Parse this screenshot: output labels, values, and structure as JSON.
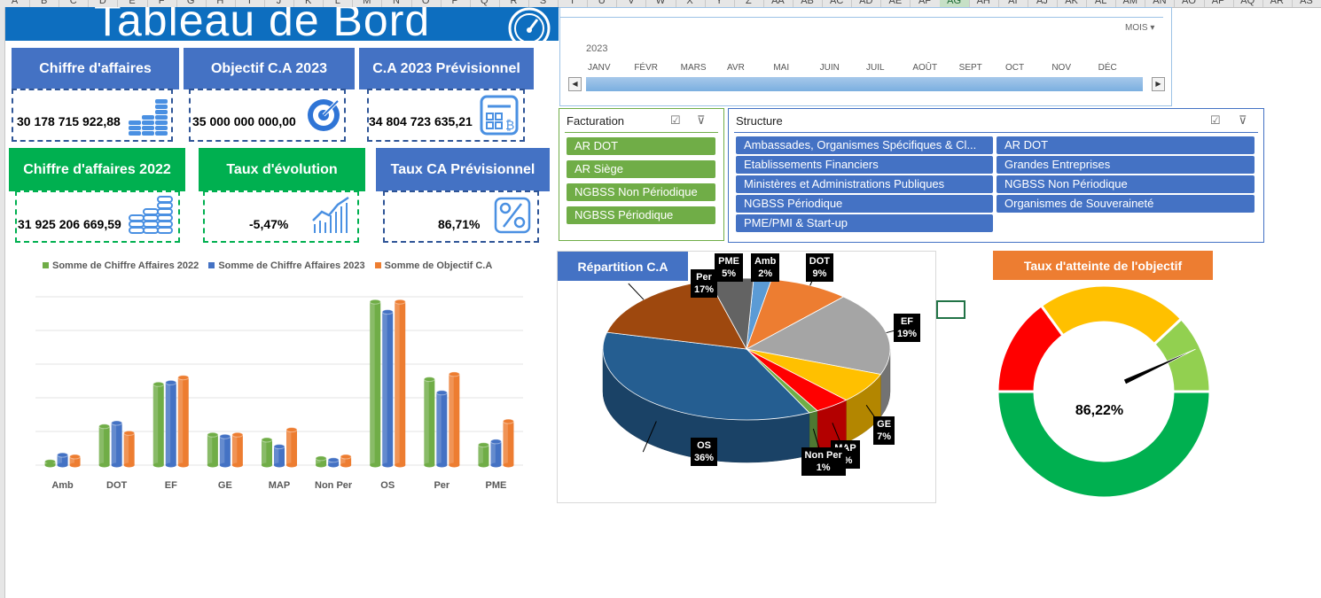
{
  "app": {
    "column_headers": [
      "A",
      "B",
      "C",
      "D",
      "E",
      "F",
      "G",
      "H",
      "I",
      "J",
      "K",
      "L",
      "M",
      "N",
      "O",
      "P",
      "Q",
      "R",
      "S",
      "T",
      "U",
      "V",
      "W",
      "X",
      "Y",
      "Z",
      "AA",
      "AB",
      "AC",
      "AD",
      "AE",
      "AF",
      "AG",
      "AH",
      "AI",
      "AJ",
      "AK",
      "AL",
      "AM",
      "AN",
      "AO",
      "AP",
      "AQ",
      "AR",
      "AS"
    ],
    "selected_column": "AG"
  },
  "dashboard": {
    "title": "Tableau de Bord",
    "kpis": [
      {
        "label": "Chiffre d'affaires",
        "value": "30 178 715 922,88",
        "icon": "coins-stack-icon",
        "color": "#4472c4"
      },
      {
        "label": "Objectif C.A 2023",
        "value": "35 000 000 000,00",
        "icon": "target-icon",
        "color": "#4472c4"
      },
      {
        "label": "C.A 2023 Prévisionnel",
        "value": "34 804 723 635,21",
        "icon": "calculator-icon",
        "color": "#4472c4"
      },
      {
        "label": "Chiffre d'affaires 2022",
        "value": "31 925 206 669,59",
        "icon": "coins-stack-icon",
        "color": "#00b050"
      },
      {
        "label": "Taux d'évolution",
        "value": "-5,47%",
        "icon": "growth-chart-icon",
        "color": "#00b050"
      },
      {
        "label": "Taux CA Prévisionnel",
        "value": "86,71%",
        "icon": "percent-icon",
        "color": "#4472c4"
      }
    ]
  },
  "timeline": {
    "period_label": "MOIS",
    "year": "2023",
    "months": [
      "JANV",
      "FÉVR",
      "MARS",
      "AVR",
      "MAI",
      "JUIN",
      "JUIL",
      "AOÛT",
      "SEPT",
      "OCT",
      "NOV",
      "DÉC"
    ]
  },
  "slicers": {
    "facturation": {
      "title": "Facturation",
      "items": [
        "AR DOT",
        "AR Siège",
        "NGBSS Non Périodique",
        "NGBSS Périodique"
      ]
    },
    "structure": {
      "title": "Structure",
      "items": [
        "Ambassades, Organismes Spécifiques & Cl...",
        "AR DOT",
        "Etablissements Financiers",
        "Grandes Entreprises",
        "Ministères et Administrations Publiques",
        "NGBSS Non Périodique",
        "NGBSS Périodique",
        "Organismes de Souveraineté",
        "PME/PMI & Start-up"
      ]
    }
  },
  "chart_data": [
    {
      "type": "bar",
      "title": "",
      "categories": [
        "Amb",
        "DOT",
        "EF",
        "GE",
        "MAP",
        "Non Per",
        "OS",
        "Per",
        "PME"
      ],
      "series": [
        {
          "name": "Somme de Chiffre Affaires 2022",
          "color": "#70ad47",
          "values": [
            0.2,
            2.3,
            4.8,
            1.8,
            1.5,
            0.4,
            9.7,
            5.1,
            1.2
          ]
        },
        {
          "name": "Somme de Chiffre Affaires 2023",
          "color": "#4472c4",
          "values": [
            0.6,
            2.5,
            4.9,
            1.7,
            1.1,
            0.3,
            9.1,
            4.3,
            1.4
          ]
        },
        {
          "name": "Somme de Objectif C.A",
          "color": "#ed7d31",
          "values": [
            0.5,
            1.9,
            5.2,
            1.8,
            2.1,
            0.5,
            9.7,
            5.4,
            2.6
          ]
        }
      ],
      "ylim": [
        0,
        10
      ],
      "legend": "top",
      "grid": true
    },
    {
      "type": "pie",
      "title": "Répartition C.A",
      "slices": [
        {
          "label": "Amb",
          "percent": "2%",
          "value": 2,
          "color": "#5b9bd5"
        },
        {
          "label": "DOT",
          "percent": "9%",
          "value": 9,
          "color": "#ed7d31"
        },
        {
          "label": "EF",
          "percent": "19%",
          "value": 19,
          "color": "#a5a5a5"
        },
        {
          "label": "GE",
          "percent": "7%",
          "value": 7,
          "color": "#ffc000"
        },
        {
          "label": "MAP",
          "percent": "4%",
          "value": 4,
          "color": "#ff0000"
        },
        {
          "label": "Non Per",
          "percent": "1%",
          "value": 1,
          "color": "#70ad47"
        },
        {
          "label": "OS",
          "percent": "36%",
          "value": 36,
          "color": "#255e91"
        },
        {
          "label": "Per",
          "percent": "17%",
          "value": 17,
          "color": "#9e480e"
        },
        {
          "label": "PME",
          "percent": "5%",
          "value": 5,
          "color": "#636363"
        }
      ]
    },
    {
      "type": "gauge",
      "title": "Taux d'atteinte de l'objectif",
      "value_label": "86,22%",
      "value": 0.8622,
      "bands": [
        {
          "color": "#00b050",
          "value": 0.5
        },
        {
          "color": "#ff0000",
          "value": 0.15
        },
        {
          "color": "#ffc000",
          "value": 0.23
        },
        {
          "color": "#92d050",
          "value": 0.12
        }
      ]
    }
  ]
}
